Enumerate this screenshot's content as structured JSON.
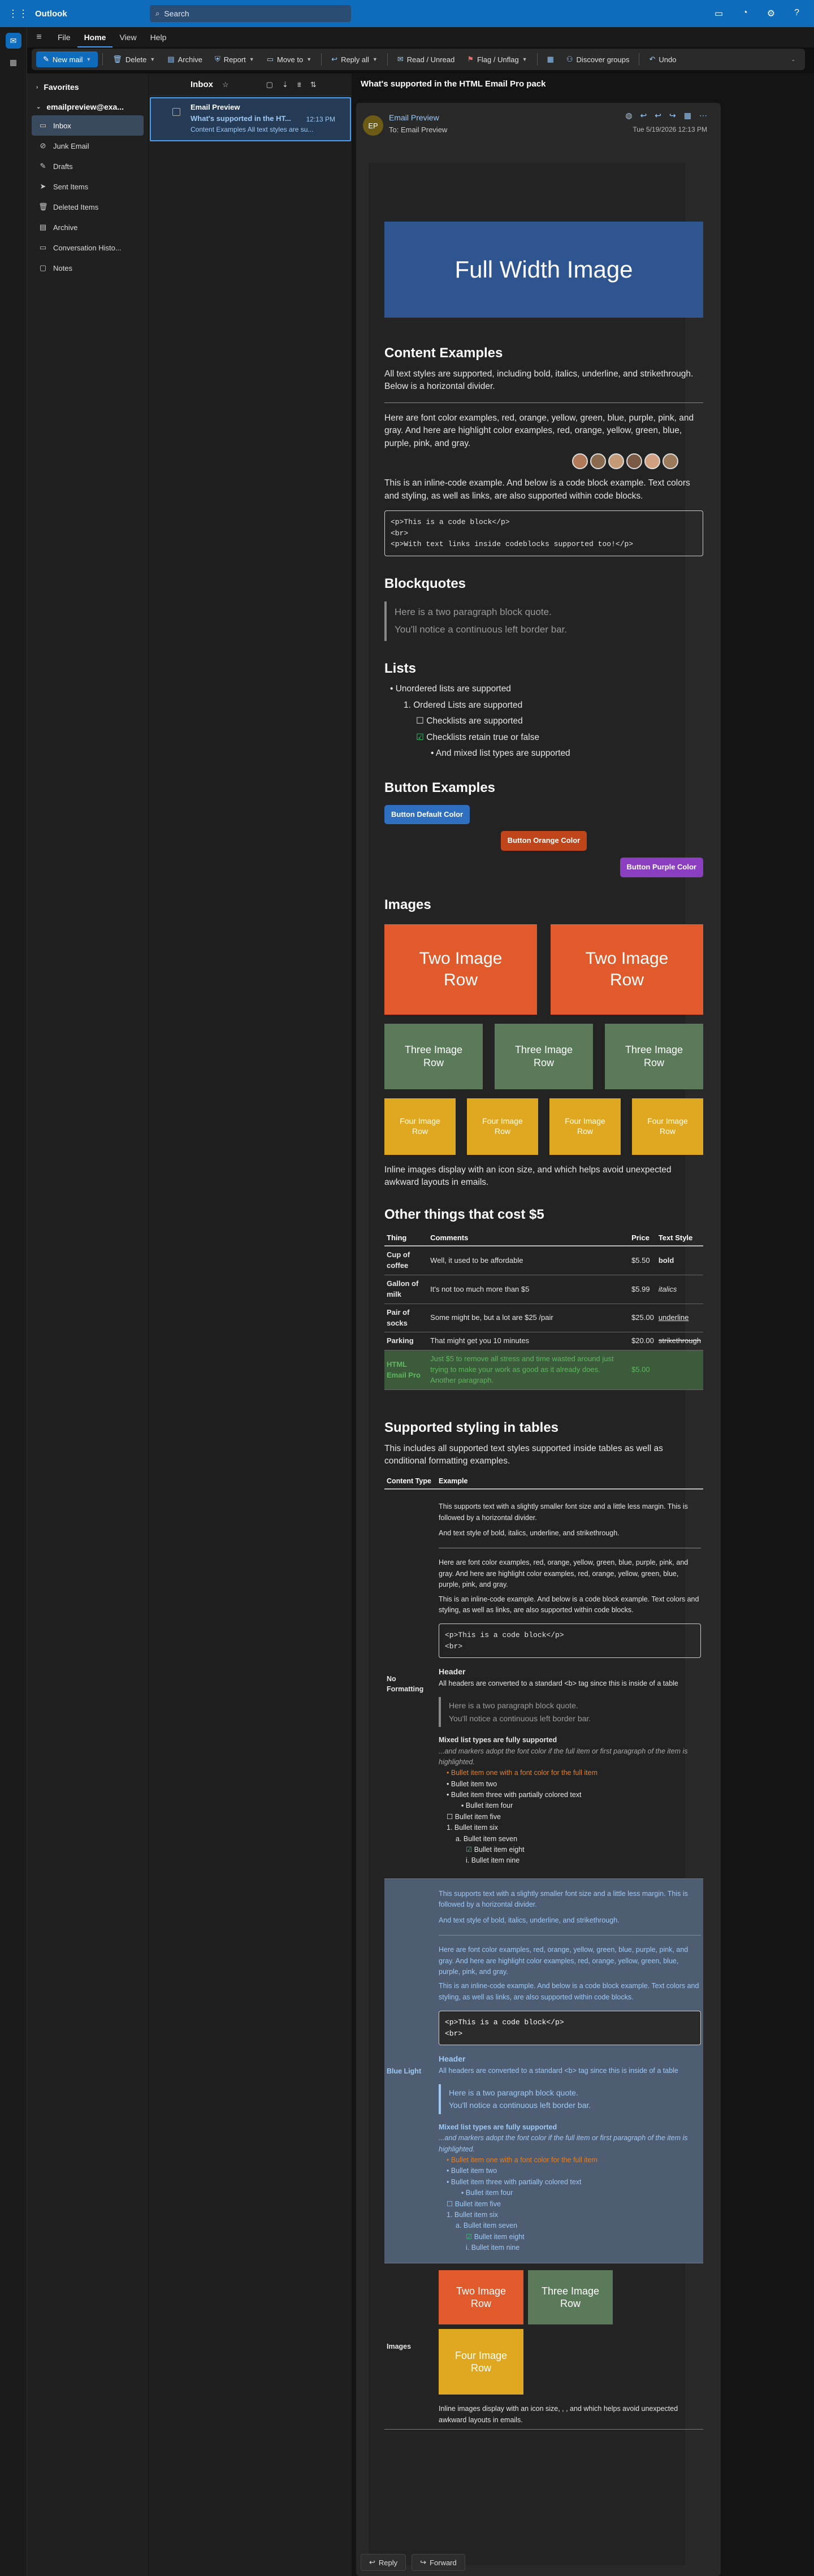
{
  "app": {
    "name": "Outlook",
    "search_placeholder": "Search"
  },
  "menu": {
    "tabs": [
      "File",
      "Home",
      "View",
      "Help"
    ]
  },
  "ribbon": {
    "new_mail": "New mail",
    "delete": "Delete",
    "archive": "Archive",
    "report": "Report",
    "move_to": "Move to",
    "reply_all": "Reply all",
    "read_unread": "Read / Unread",
    "flag": "Flag / Unflag",
    "discover": "Discover groups",
    "undo": "Undo"
  },
  "sidebar": {
    "favorites": "Favorites",
    "account": "emailpreview@exa...",
    "folders": [
      "Inbox",
      "Junk Email",
      "Drafts",
      "Sent Items",
      "Deleted Items",
      "Archive",
      "Conversation Histo...",
      "Notes"
    ]
  },
  "list": {
    "title": "Inbox",
    "from": "Email Preview",
    "subject": "What's supported in the HT...",
    "time": "12:13 PM",
    "preview": "Content Examples All text styles are su..."
  },
  "message": {
    "subject": "What's supported in the HTML Email Pro pack",
    "avatar": "EP",
    "from": "Email Preview",
    "to": "To:  Email Preview",
    "date": "Tue 5/19/2026 12:13 PM"
  },
  "email": {
    "hero": "Full Width Image",
    "content_title": "Content Examples",
    "content_p1": "All text styles are supported, including bold, italics, underline, and strikethrough. Below is a horizontal divider.",
    "colors_p": "Here are font color examples, red, orange, yellow, green, blue, purple, pink, and gray. And here are highlight color examples, red, orange, yellow, green, blue, purple, pink, and gray.",
    "code_p": "This is an inline-code example. And below is a code block example. Text colors and styling, as well as links, are also supported within code blocks.",
    "code_block": [
      "<p>This is a code block</p>",
      "<br>",
      "<p>With text links inside codeblocks supported too!</p>"
    ],
    "bq_title": "Blockquotes",
    "bq": [
      "Here is a two paragraph block quote.",
      "You'll notice a continuous left border bar."
    ],
    "lists_title": "Lists",
    "lists": [
      "Unordered lists are supported",
      "Ordered Lists are supported",
      "Checklists are supported",
      "Checklists retain true or false",
      "And mixed list types are supported"
    ],
    "buttons_title": "Button Examples",
    "buttons": [
      "Button Default Color",
      "Button Orange Color",
      "Button Purple Color"
    ],
    "images_title": "Images",
    "img2": "Two Image Row",
    "img3": "Three Image Row",
    "img4": "Four Image Row",
    "inline_img_p": "Inline images display with an icon size, and which helps avoid unexpected awkward layouts in emails.",
    "table_title": "Other things that cost $5",
    "table_head": [
      "Thing",
      "Comments",
      "Price",
      "Text Style"
    ],
    "table_rows": [
      [
        "Cup of coffee",
        "Well, it used to be affordable",
        "$5.50",
        "bold"
      ],
      [
        "Gallon of milk",
        "It's not too much more than $5",
        "$5.99",
        "italics"
      ],
      [
        "Pair of socks",
        "Some might be, but a lot are $25 /pair",
        "$25.00",
        "underline"
      ],
      [
        "Parking",
        "That might get you 10 minutes",
        "$20.00",
        "strikethrough"
      ],
      [
        "HTML Email Pro",
        "Just $5 to remove all stress and time wasted around just trying to make your work as good as it already does. Another paragraph.",
        "$5.00",
        ""
      ]
    ],
    "styled_title": "Supported styling in tables",
    "styled_intro": "This includes all supported text styles supported inside tables as well as conditional formatting examples.",
    "styled_head": [
      "Content Type",
      "Example"
    ],
    "no_format": "No Formatting",
    "blue_light": "Blue Light",
    "images_label": "Images",
    "nf_p1": "This supports text with a slightly smaller font size and a little less margin. This is followed by a horizontal divider.",
    "nf_p2": "And text style of bold, italics, underline, and strikethrough.",
    "nf_header": "Header",
    "nf_header_p": "All headers are converted to a standard <b> tag since this is inside of a table",
    "nf_mixed": "Mixed list types are fully supported",
    "nf_mixed_note": "...and markers adopt the font color if the full item or first paragraph of the item is highlighted.",
    "nf_list": [
      "Bullet item one with a font color for the full item",
      "Bullet item two",
      "Bullet item three with partially colored text",
      "Bullet item four",
      "Bullet item five",
      "Bullet item six",
      "Bullet item seven",
      "Bullet item eight",
      "Bullet item nine"
    ],
    "inline_img_p2": "Inline images display with an icon size, , , and which helps avoid unexpected awkward layouts in emails."
  },
  "bottom": {
    "reply": "Reply",
    "forward": "Forward"
  }
}
